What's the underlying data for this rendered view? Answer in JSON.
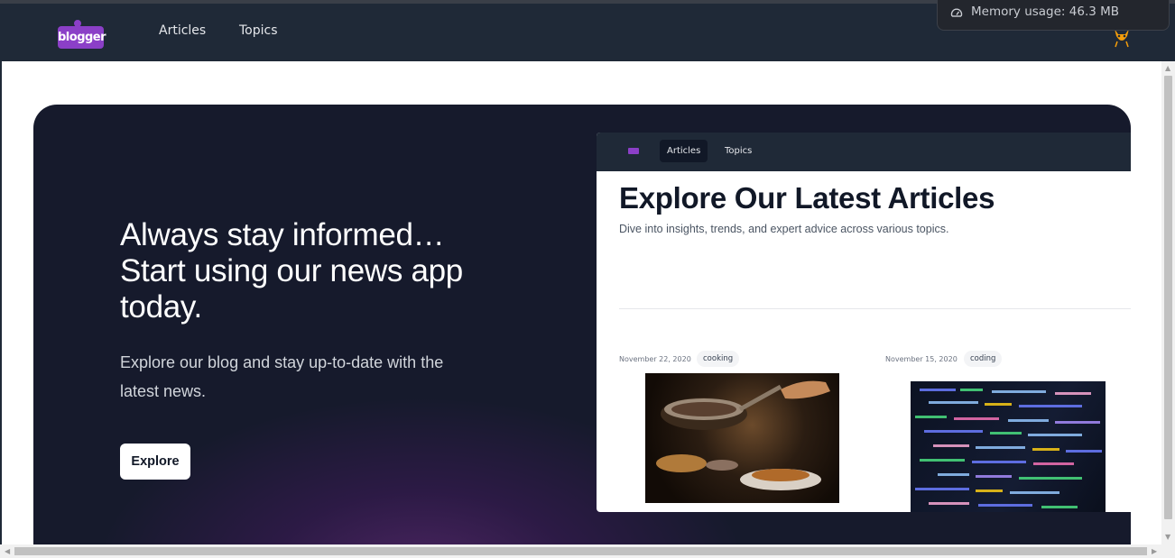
{
  "nav": {
    "logo_text": "blogger",
    "links": [
      {
        "label": "Articles"
      },
      {
        "label": "Topics"
      }
    ]
  },
  "memory_popup": {
    "text": "Memory usage: 46.3 MB"
  },
  "hero": {
    "headline": "Always stay informed… Start using our news app today.",
    "subtext": "Explore our blog and stay up-to-date with the latest news.",
    "cta_label": "Explore"
  },
  "preview": {
    "tabs": [
      {
        "label": "Articles",
        "active": true
      },
      {
        "label": "Topics",
        "active": false
      }
    ],
    "title": "Explore Our Latest Articles",
    "subtitle": "Dive into insights, trends, and expert advice across various topics.",
    "articles": [
      {
        "date": "November 22, 2020",
        "tag": "cooking",
        "image": "cooking-photo"
      },
      {
        "date": "November 15, 2020",
        "tag": "coding",
        "image": "code-photo"
      }
    ]
  },
  "colors": {
    "nav_bg": "#1f2937",
    "hero_bg": "#141a2b",
    "brand_purple": "#8b3fc7",
    "accent_glow": "#4a2560"
  }
}
